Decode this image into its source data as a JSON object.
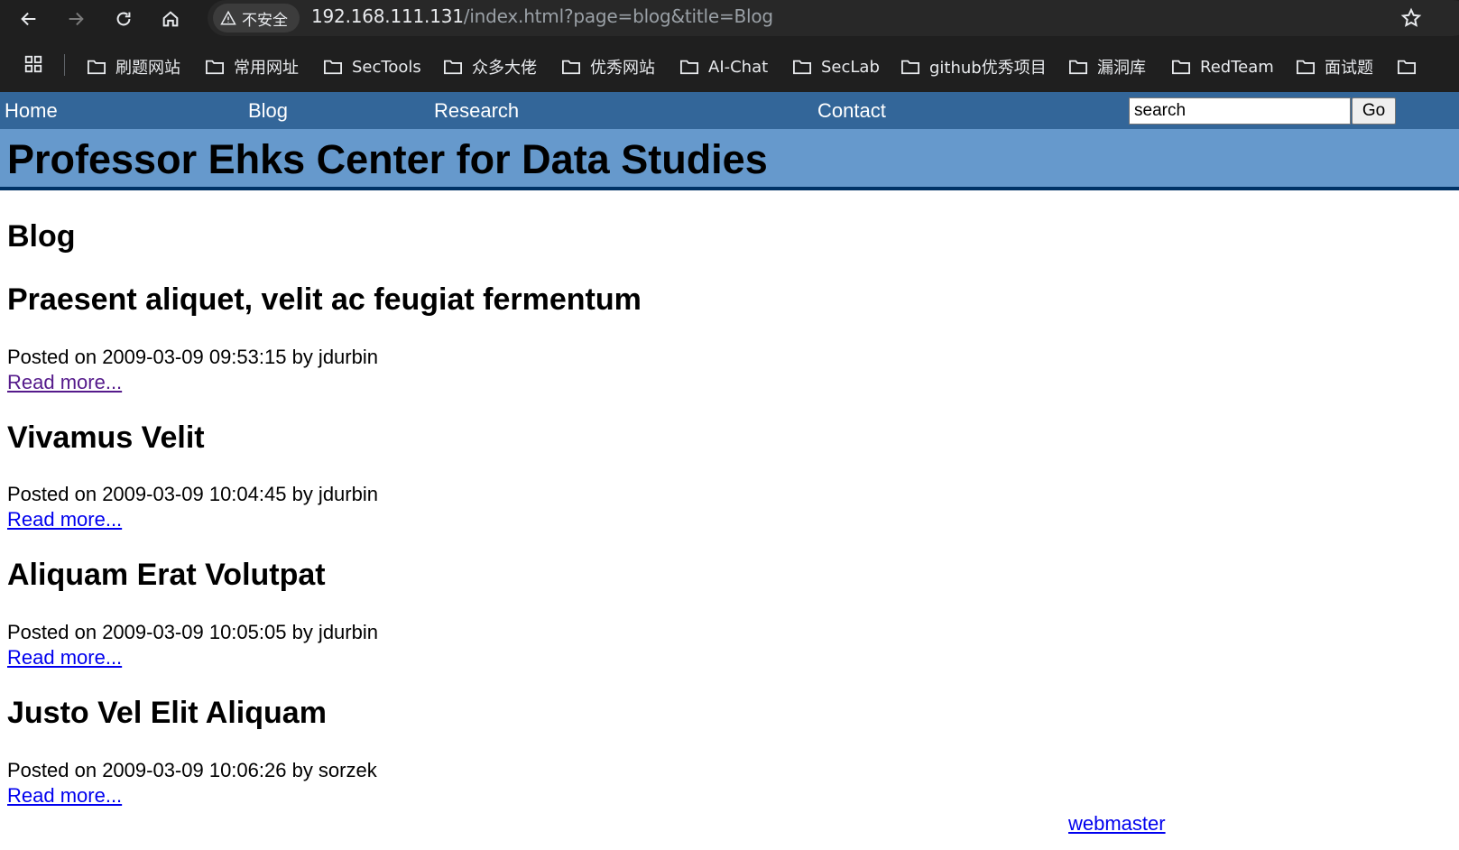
{
  "browser": {
    "security_label": "不安全",
    "url_host": "192.168.111.131",
    "url_path": "/index.html?page=blog&title=Blog",
    "bookmarks": [
      "刷题网站",
      "常用网址",
      "SecTools",
      "众多大佬",
      "优秀网站",
      "AI-Chat",
      "SecLab",
      "github优秀项目",
      "漏洞库",
      "RedTeam",
      "面试题"
    ]
  },
  "nav": {
    "home": "Home",
    "blog": "Blog",
    "research": "Research",
    "contact": "Contact",
    "search_value": "search",
    "go": "Go"
  },
  "site_title": "Professor Ehks Center for Data Studies",
  "page_heading": "Blog",
  "posts": [
    {
      "title": "Praesent aliquet, velit ac feugiat fermentum",
      "meta": "Posted on 2009-03-09 09:53:15 by jdurbin",
      "link": "Read more...",
      "visited": true
    },
    {
      "title": "Vivamus Velit",
      "meta": "Posted on 2009-03-09 10:04:45 by jdurbin",
      "link": "Read more...",
      "visited": false
    },
    {
      "title": "Aliquam Erat Volutpat",
      "meta": "Posted on 2009-03-09 10:05:05 by jdurbin",
      "link": "Read more...",
      "visited": false
    },
    {
      "title": "Justo Vel Elit Aliquam",
      "meta": "Posted on 2009-03-09 10:06:26 by sorzek",
      "link": "Read more...",
      "visited": false
    }
  ],
  "footer_link": "webmaster",
  "colors": {
    "nav_bar": "#336699",
    "banner": "#6699cc",
    "banner_border": "#003366",
    "link": "#0000ee",
    "visited_link": "#551a8b"
  }
}
